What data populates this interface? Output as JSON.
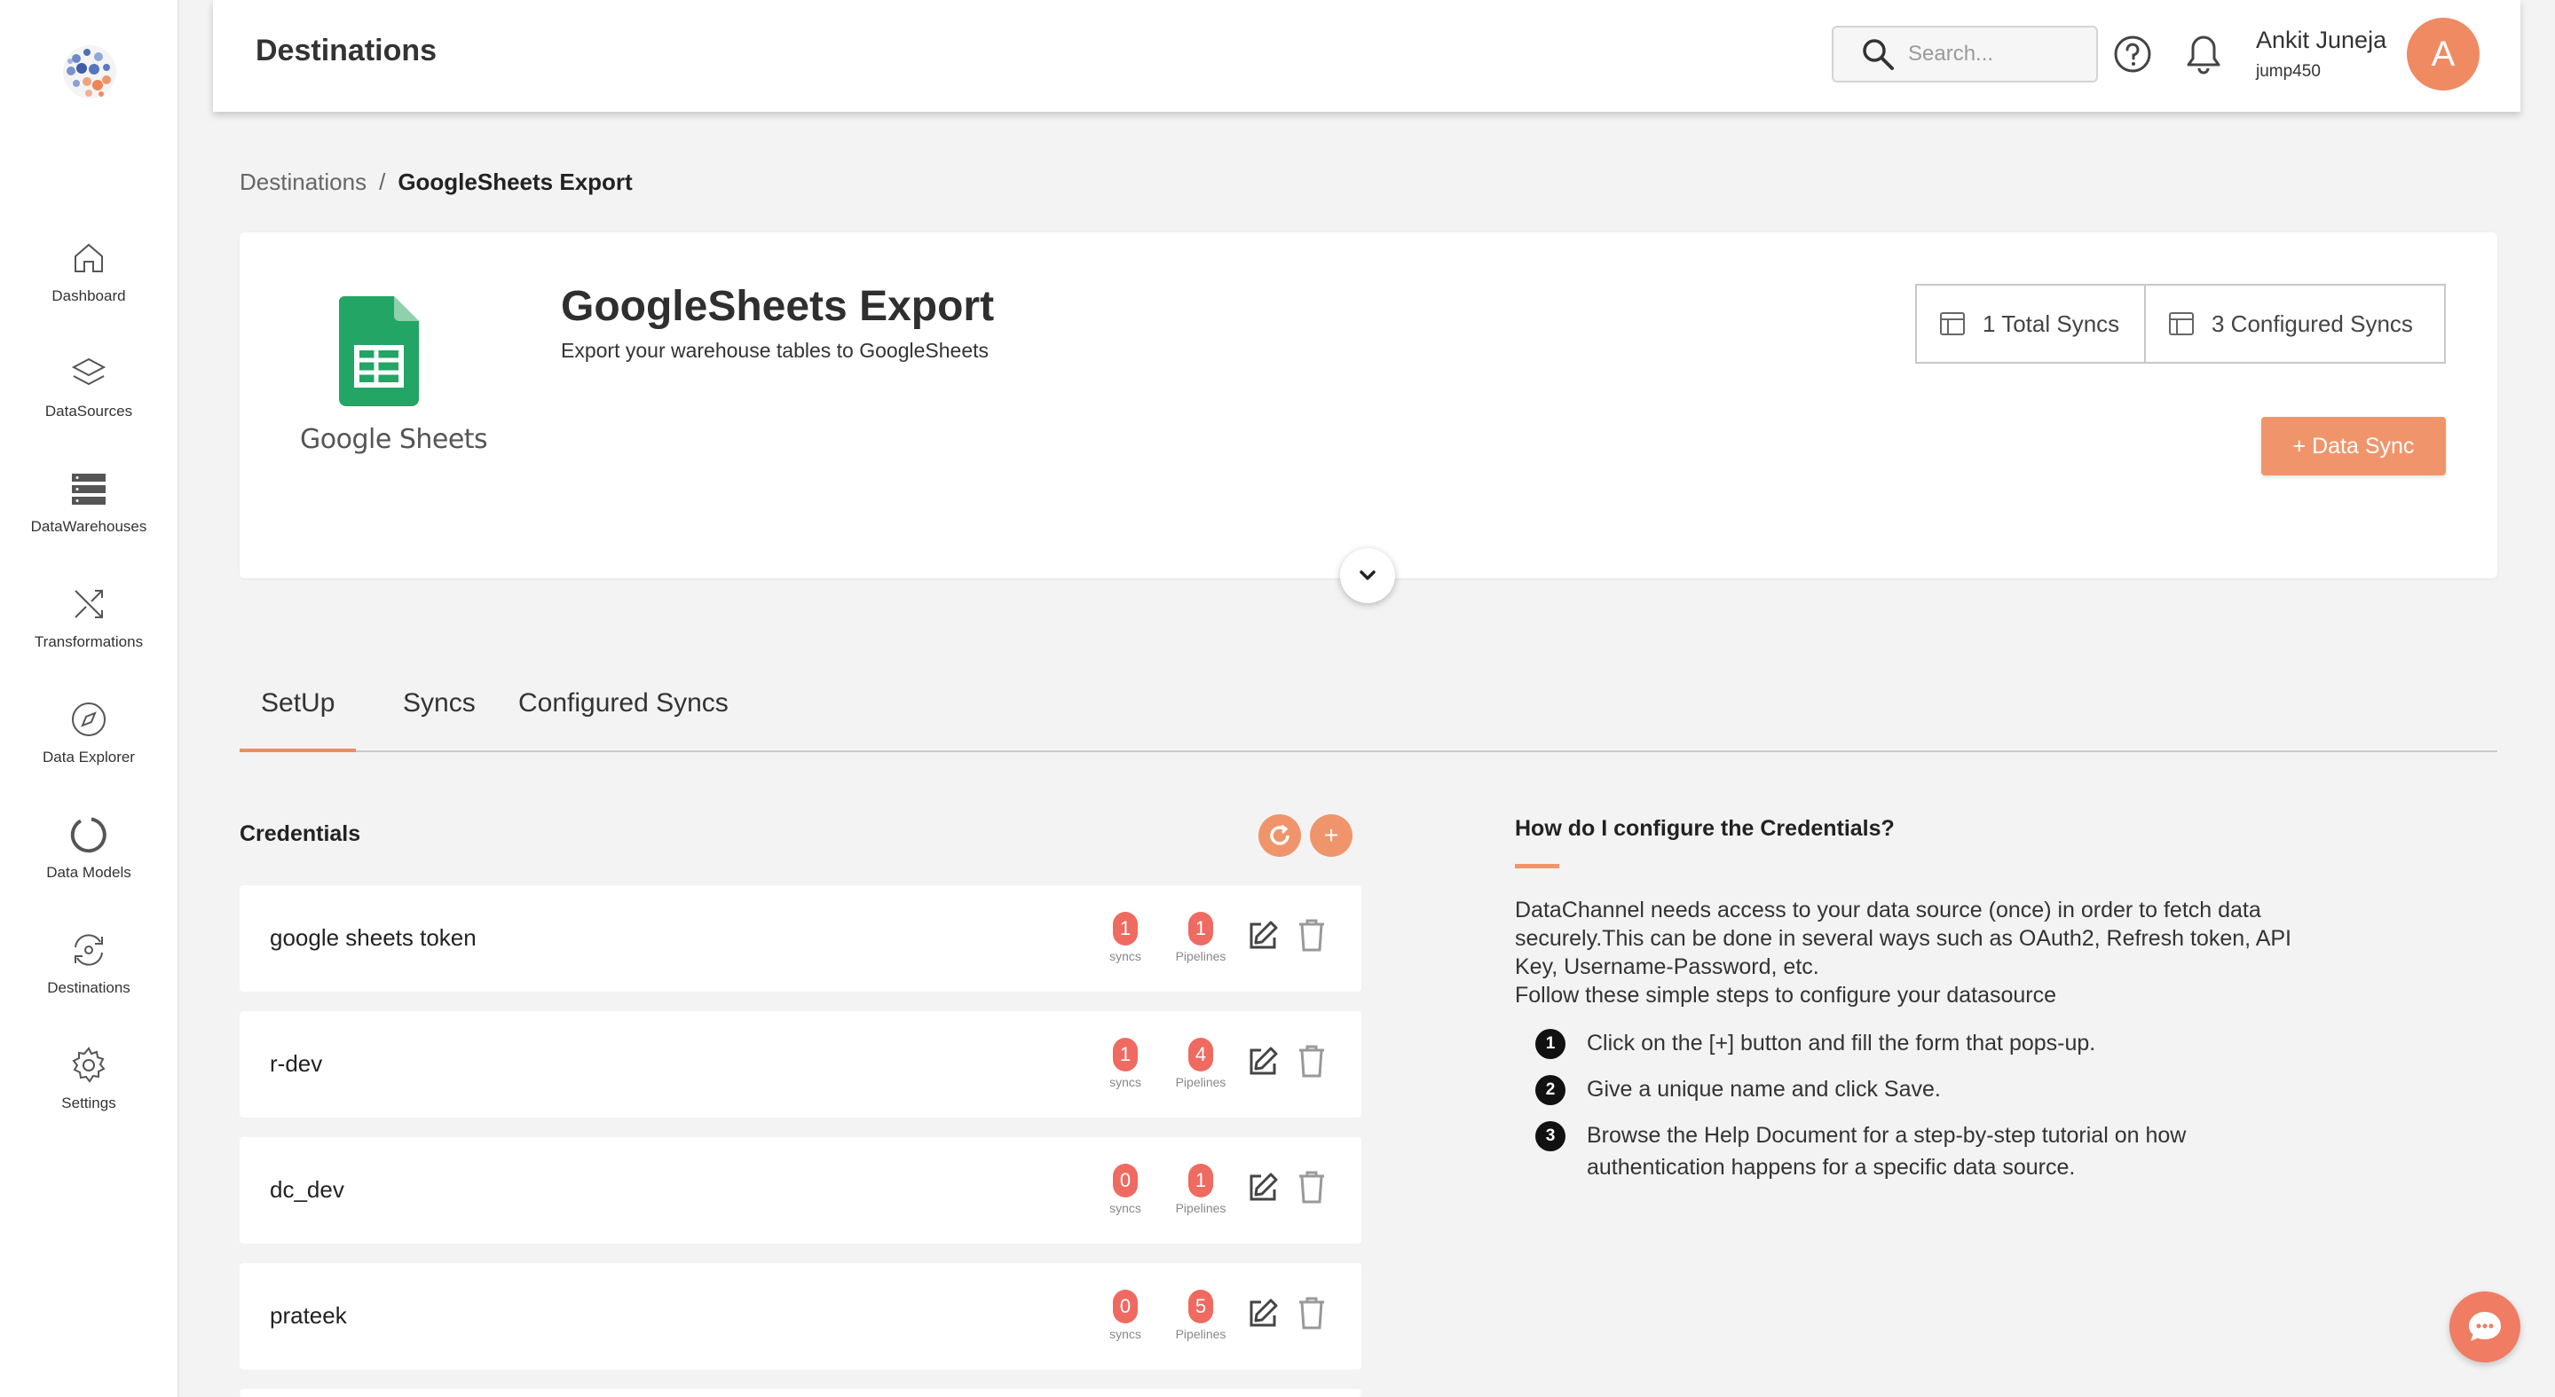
{
  "header": {
    "title": "Destinations",
    "search_placeholder": "Search...",
    "user_name": "Ankit Juneja",
    "user_handle": "jump450",
    "avatar_initial": "A"
  },
  "sidebar": {
    "items": [
      {
        "label": "Dashboard",
        "icon": "home-icon"
      },
      {
        "label": "DataSources",
        "icon": "layers-icon"
      },
      {
        "label": "DataWarehouses",
        "icon": "server-icon"
      },
      {
        "label": "Transformations",
        "icon": "shuffle-icon"
      },
      {
        "label": "Data Explorer",
        "icon": "compass-icon"
      },
      {
        "label": "Data Models",
        "icon": "circle-notch-icon"
      },
      {
        "label": "Destinations",
        "icon": "sync-icon"
      },
      {
        "label": "Settings",
        "icon": "gear-icon"
      }
    ]
  },
  "breadcrumb": {
    "parent": "Destinations",
    "separator": "/",
    "current": "GoogleSheets Export"
  },
  "hero": {
    "logo_text": "Google Sheets",
    "title": "GoogleSheets Export",
    "subtitle": "Export your warehouse tables to GoogleSheets",
    "total_syncs": "1 Total Syncs",
    "configured_syncs": "3 Configured Syncs",
    "data_sync_button": "+ Data Sync"
  },
  "tabs": [
    {
      "label": "SetUp",
      "active": true
    },
    {
      "label": "Syncs",
      "active": false
    },
    {
      "label": "Configured Syncs",
      "active": false
    }
  ],
  "credentials": {
    "title": "Credentials",
    "add_label": "+",
    "rows": [
      {
        "name": "google sheets token",
        "syncs": "1",
        "pipelines": "1",
        "syncs_caption": "syncs",
        "pipelines_caption": "Pipelines"
      },
      {
        "name": "r-dev",
        "syncs": "1",
        "pipelines": "4",
        "syncs_caption": "syncs",
        "pipelines_caption": "Pipelines"
      },
      {
        "name": "dc_dev",
        "syncs": "0",
        "pipelines": "1",
        "syncs_caption": "syncs",
        "pipelines_caption": "Pipelines"
      },
      {
        "name": "prateek",
        "syncs": "0",
        "pipelines": "5",
        "syncs_caption": "syncs",
        "pipelines_caption": "Pipelines"
      }
    ]
  },
  "help": {
    "title": "How do I configure the Credentials?",
    "line1": "DataChannel needs access to your data source (once) in order to fetch data",
    "line2": "securely.This can be done in several ways such as OAuth2, Refresh token, API",
    "line3": "Key, Username-Password, etc.",
    "line4": "Follow these simple steps to configure your datasource",
    "steps": [
      {
        "num": "1",
        "text": "Click on the [+] button and fill the form that pops-up."
      },
      {
        "num": "2",
        "text": "Give a unique name and click Save."
      },
      {
        "num": "3",
        "text": "Browse the Help Document for a step-by-step tutorial on how authentication happens for a specific data source."
      }
    ]
  },
  "colors": {
    "accent": "#f0956b",
    "badge": "#ef6a61",
    "avatar": "#ef8a63",
    "sheets_green": "#22a565"
  }
}
